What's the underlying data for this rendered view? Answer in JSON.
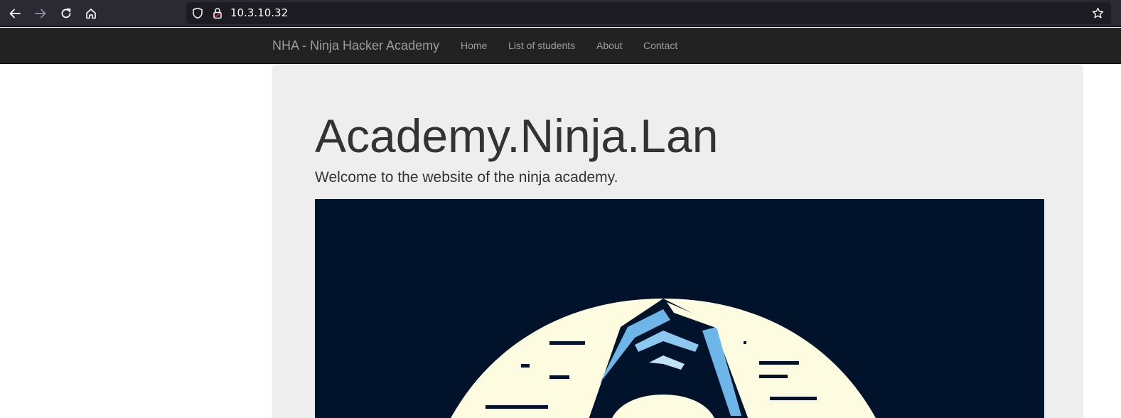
{
  "browser": {
    "url": "10.3.10.32",
    "icons": [
      "back-arrow-icon",
      "forward-arrow-icon",
      "reload-icon",
      "home-icon",
      "shield-icon",
      "lock-icon",
      "bookmark-star-icon"
    ]
  },
  "navbar": {
    "brand": "NHA - Ninja Hacker Academy",
    "links": [
      "Home",
      "List of students",
      "About",
      "Contact"
    ]
  },
  "jumbotron": {
    "title": "Academy.Ninja.Lan",
    "lead": "Welcome to the website of the ninja academy."
  },
  "colors": {
    "chrome_bg": "#2b2a33",
    "urlbar_bg": "#1c1b22",
    "navbar_bg": "#222222",
    "nav_text": "#9d9d9d",
    "jumbotron_bg": "#eeeeee",
    "text": "#333333",
    "hero_bg": "#01132b",
    "hero_moon": "#fdfbe0",
    "hero_accent": "#6fb6e8"
  }
}
